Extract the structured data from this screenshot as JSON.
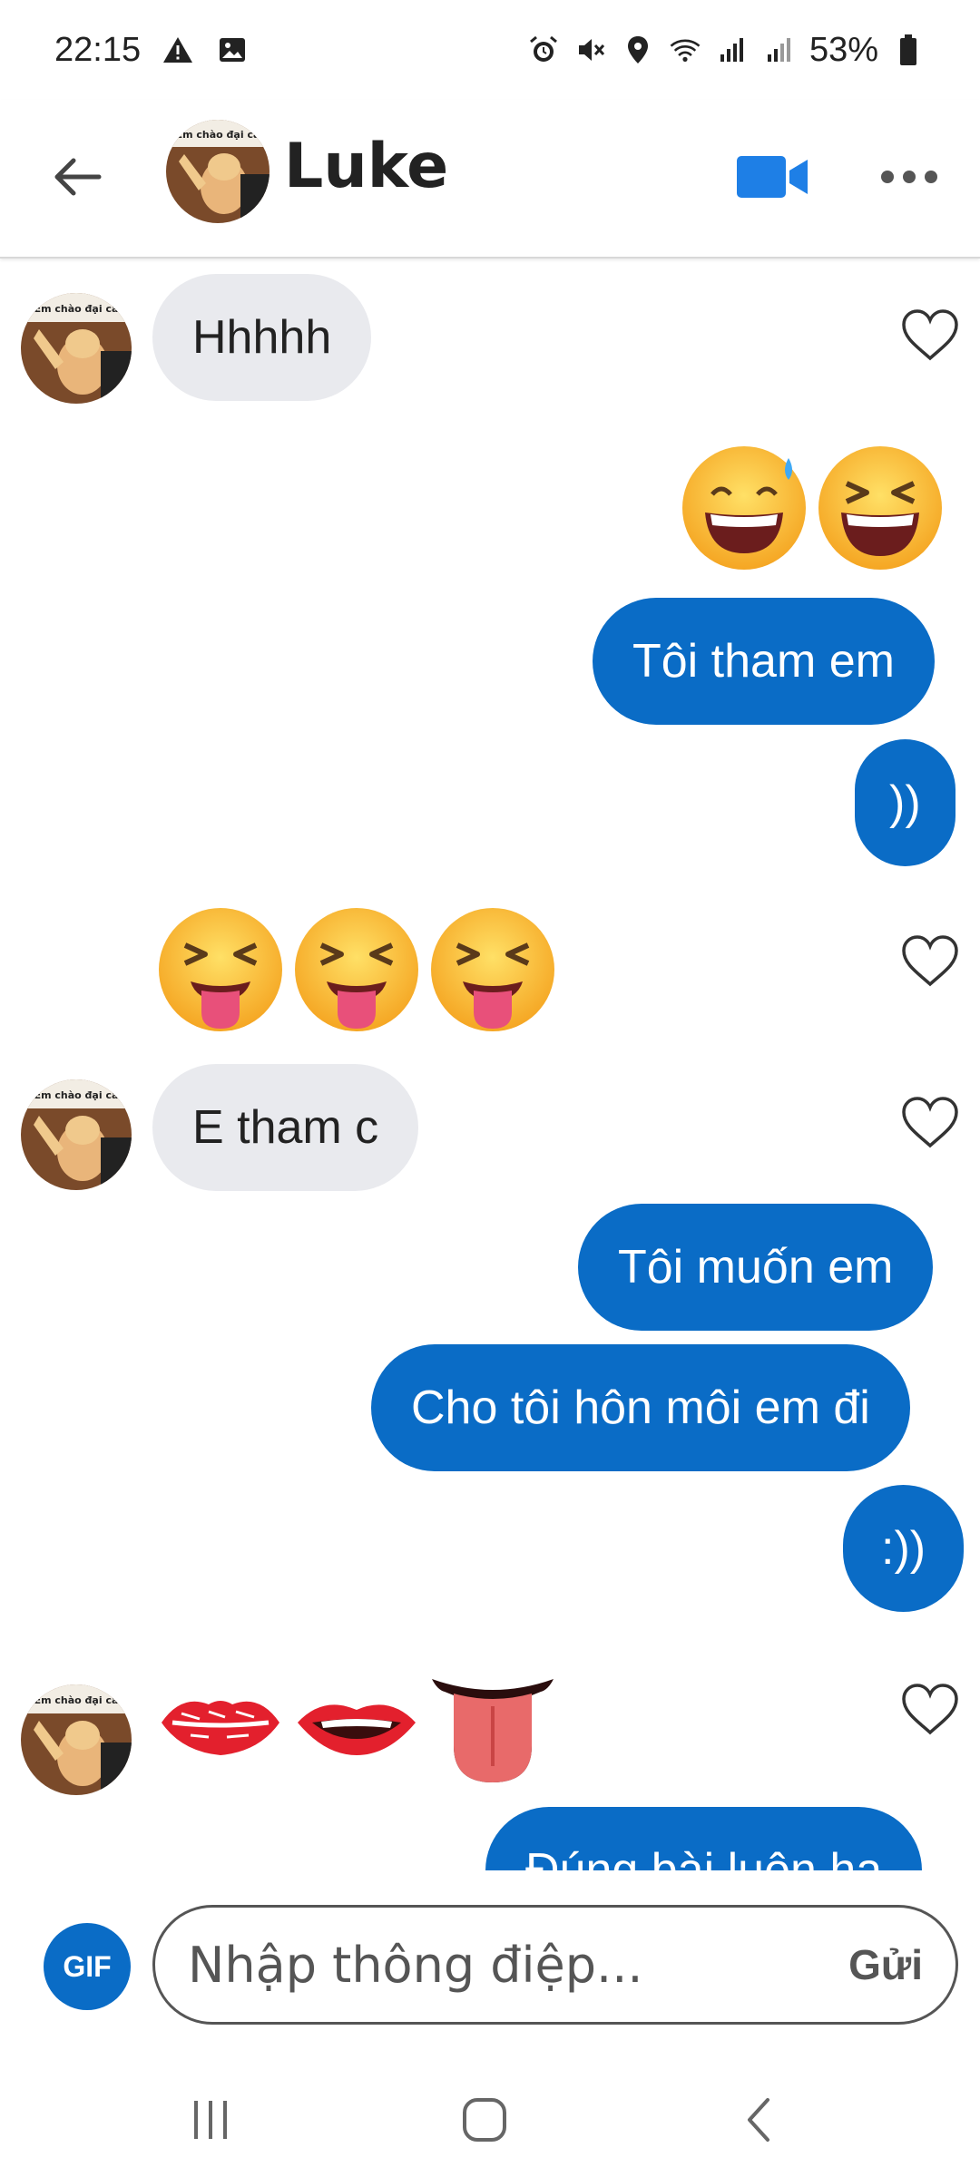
{
  "status_bar": {
    "time": "22:15",
    "battery": "53%",
    "left_icons": [
      "warning-icon",
      "image-icon"
    ],
    "right_icons": [
      "alarm-icon",
      "mute-icon",
      "location-icon",
      "wifi-icon",
      "signal-icon",
      "signal-icon-2",
      "battery-icon"
    ]
  },
  "header": {
    "contact_name": "Luke",
    "avatar_caption": "Em chào đại ca",
    "back_icon": "arrow-left-icon",
    "video_icon": "video-camera-icon",
    "more_icon": "more-dots-icon"
  },
  "colors": {
    "accent": "#0a6cc6",
    "incoming_bubble": "#e9eaee",
    "heart_outline": "#333333"
  },
  "messages": [
    {
      "side": "in",
      "type": "text",
      "text": "Hhhhh"
    },
    {
      "side": "out",
      "type": "emoji",
      "emojis": [
        "😅",
        "😆"
      ]
    },
    {
      "side": "out",
      "type": "text",
      "text": "Tôi tham em"
    },
    {
      "side": "out",
      "type": "text",
      "text": "))"
    },
    {
      "side": "in",
      "type": "emoji",
      "emojis": [
        "😝",
        "😝",
        "😝"
      ]
    },
    {
      "side": "in",
      "type": "text",
      "text": "E tham c"
    },
    {
      "side": "out",
      "type": "text",
      "text": "Tôi muốn em"
    },
    {
      "side": "out",
      "type": "text",
      "text": "Cho tôi hôn môi em đi"
    },
    {
      "side": "out",
      "type": "text",
      "text": ":))"
    },
    {
      "side": "in",
      "type": "emoji",
      "emojis": [
        "💋",
        "👄",
        "👅"
      ]
    },
    {
      "side": "out",
      "type": "text",
      "text": "Đúng bài luôn ha"
    }
  ],
  "composer": {
    "gif_label": "GIF",
    "placeholder": "Nhập thông điệp...",
    "send_label": "Gửi"
  },
  "navbar": {
    "icons": [
      "recent-apps-icon",
      "home-icon",
      "back-nav-icon"
    ]
  }
}
